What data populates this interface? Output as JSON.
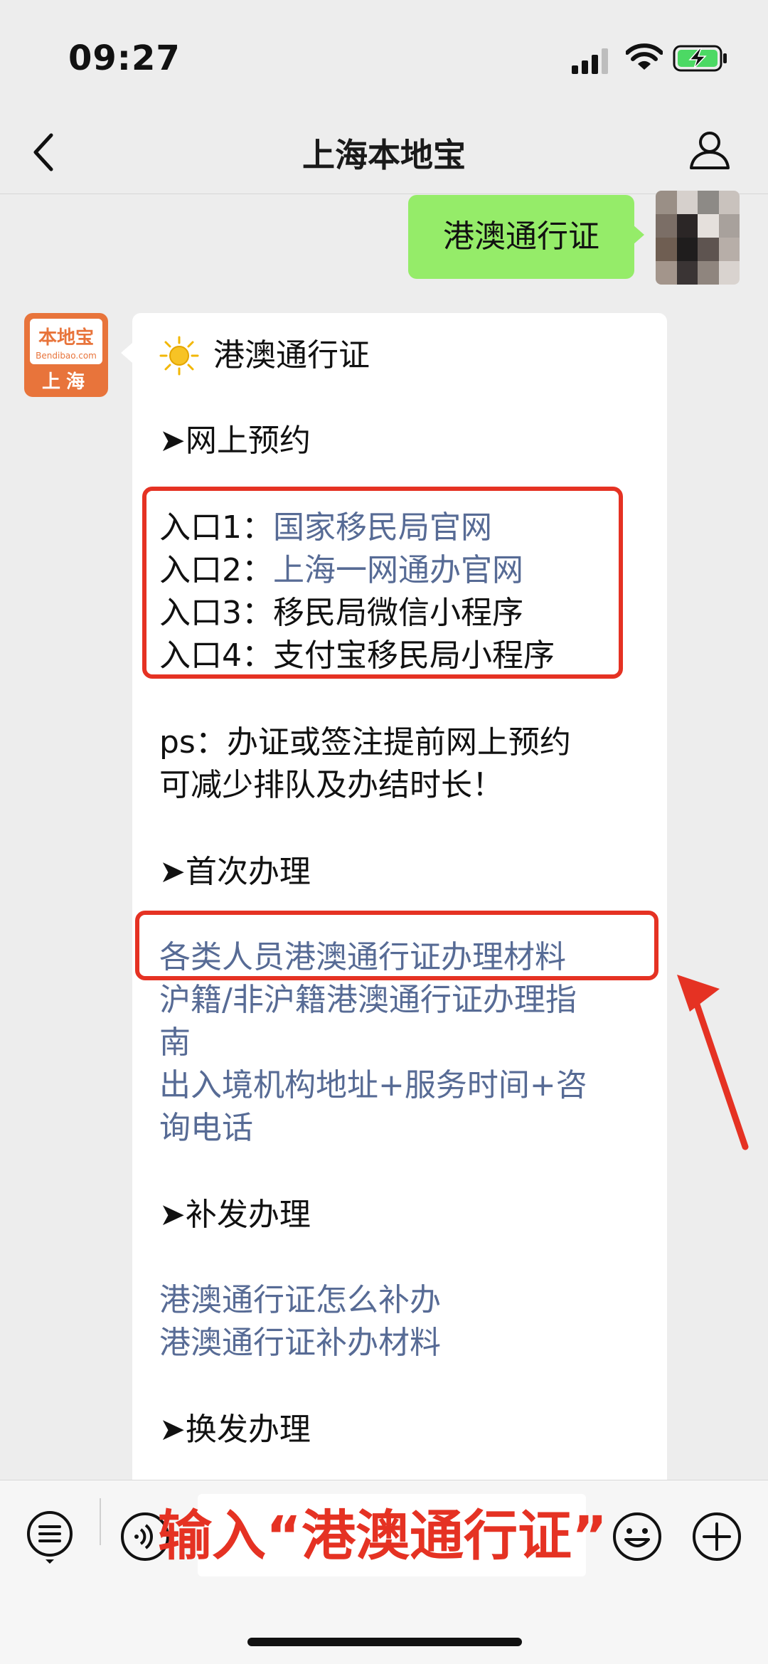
{
  "status_bar": {
    "time": "09:27"
  },
  "nav": {
    "title": "上海本地宝"
  },
  "outgoing_message": "港澳通行证",
  "bot": {
    "logo_text": "本地宝",
    "logo_sub": "Bendibao.com",
    "city": "上海"
  },
  "reply": {
    "heading": "港澳通行证",
    "section_online": "➤网上预约",
    "entries": [
      {
        "prefix": "入口1：",
        "text": "国家移民局官网",
        "is_link": true
      },
      {
        "prefix": "入口2：",
        "text": "上海一网通办官网",
        "is_link": true
      },
      {
        "prefix": "入口3：",
        "text": "移民局微信小程序",
        "is_link": false
      },
      {
        "prefix": "入口4：",
        "text": "支付宝移民局小程序",
        "is_link": false
      }
    ],
    "ps_line1": "ps：办证或签注提前网上预约",
    "ps_line2": "可减少排队及办结时长！",
    "section_first": "➤首次办理",
    "first_links": [
      "各类人员港澳通行证办理材料",
      "沪籍/非沪籍港澳通行证办理指",
      "南",
      "出入境机构地址+服务时间+咨",
      "询电话"
    ],
    "section_reissue": "➤补发办理",
    "reissue_links": [
      "港澳通行证怎么补办",
      "港澳通行证补办材料"
    ],
    "section_renew": "➤换发办理"
  },
  "annotation": {
    "input_hint": "输入“港澳通行证”"
  },
  "colors": {
    "accent_red": "#e53223",
    "link": "#576b95",
    "bubble_green": "#95ec69"
  }
}
